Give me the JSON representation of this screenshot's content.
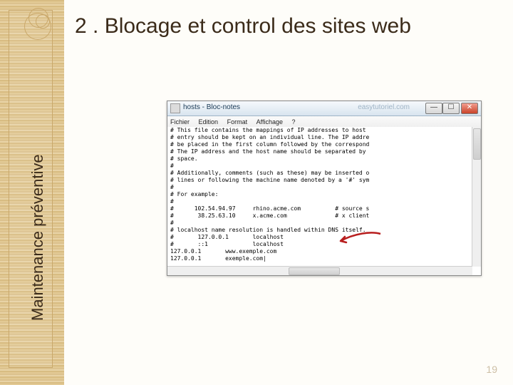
{
  "slide": {
    "title": "2 . Blocage et control des sites web",
    "vertical_label": "Maintenance préventive",
    "page_number": "19"
  },
  "window": {
    "title": "hosts - Bloc-notes",
    "watermark": "easytutoriel.com",
    "buttons": {
      "min": "—",
      "max": "☐",
      "close": "✕"
    }
  },
  "menu": {
    "file": "Fichier",
    "edit": "Edition",
    "format": "Format",
    "view": "Affichage",
    "help": "?"
  },
  "file_content": "# This file contains the mappings of IP addresses to host\n# entry should be kept on an individual line. The IP addre\n# be placed in the first column followed by the correspond\n# The IP address and the host name should be separated by\n# space.\n#\n# Additionally, comments (such as these) may be inserted o\n# lines or following the machine name denoted by a '#' sym\n#\n# For example:\n#\n#      102.54.94.97     rhino.acme.com          # source s\n#       38.25.63.10     x.acme.com              # x client\n#\n# localhost name resolution is handled within DNS itself.\n#       127.0.0.1       localhost\n#       ::1             localhost\n127.0.0.1       www.exemple.com\n127.0.0.1       exemple.com|"
}
